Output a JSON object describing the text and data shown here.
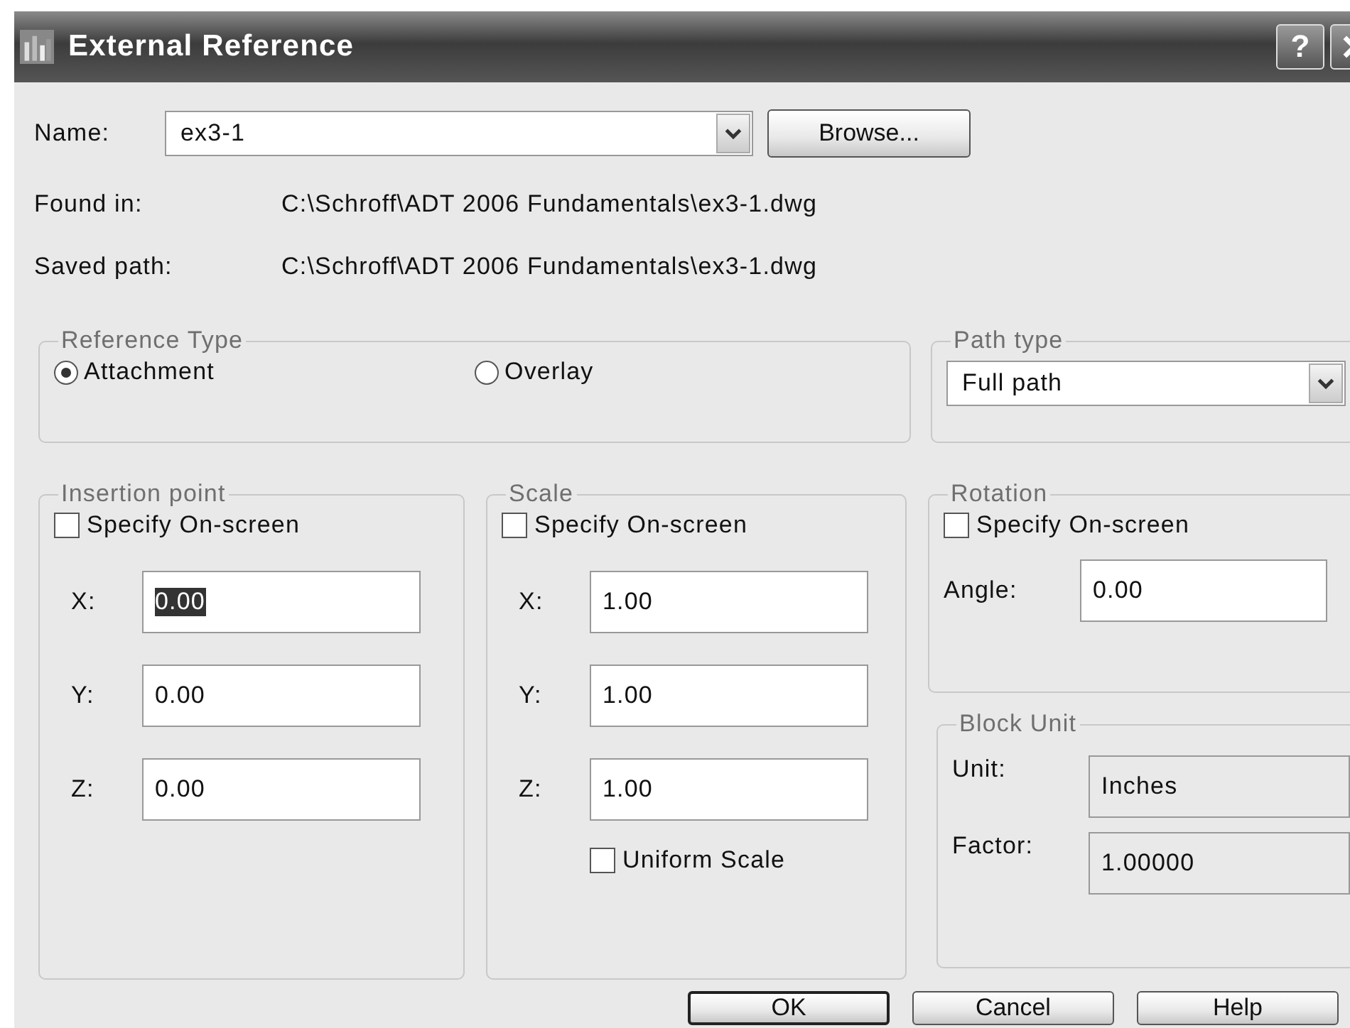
{
  "window": {
    "title": "External Reference",
    "help_button": "?"
  },
  "name": {
    "label": "Name:",
    "value": "ex3-1"
  },
  "browse_button": "Browse...",
  "info": [
    {
      "label": "Found in:",
      "value": "C:\\Schroff\\ADT 2006 Fundamentals\\ex3-1.dwg"
    },
    {
      "label": "Saved path:",
      "value": "C:\\Schroff\\ADT 2006 Fundamentals\\ex3-1.dwg"
    }
  ],
  "reference_type": {
    "title": "Reference Type",
    "options": [
      {
        "label": "Attachment",
        "selected": true
      },
      {
        "label": "Overlay",
        "selected": false
      }
    ]
  },
  "path_type": {
    "title": "Path type",
    "value": "Full path"
  },
  "insertion_point": {
    "title": "Insertion point",
    "specify_on_screen": {
      "label": "Specify On-screen",
      "checked": false
    },
    "fields": [
      {
        "label": "X:",
        "value": "0.00",
        "text_selected": true
      },
      {
        "label": "Y:",
        "value": "0.00",
        "text_selected": false
      },
      {
        "label": "Z:",
        "value": "0.00",
        "text_selected": false
      }
    ]
  },
  "scale": {
    "title": "Scale",
    "specify_on_screen": {
      "label": "Specify On-screen",
      "checked": false
    },
    "fields": [
      {
        "label": "X:",
        "value": "1.00",
        "text_selected": false
      },
      {
        "label": "Y:",
        "value": "1.00",
        "text_selected": false
      },
      {
        "label": "Z:",
        "value": "1.00",
        "text_selected": false
      }
    ],
    "uniform_scale": {
      "label": "Uniform Scale",
      "checked": false
    }
  },
  "rotation": {
    "title": "Rotation",
    "specify_on_screen": {
      "label": "Specify On-screen",
      "checked": false
    },
    "angle": {
      "label": "Angle:",
      "value": "0.00"
    }
  },
  "block_unit": {
    "title": "Block Unit",
    "fields": [
      {
        "label": "Unit:",
        "value": "Inches"
      },
      {
        "label": "Factor:",
        "value": "1.00000"
      }
    ]
  },
  "buttons": [
    {
      "label": "OK",
      "default": true
    },
    {
      "label": "Cancel",
      "default": false
    },
    {
      "label": "Help",
      "default": false
    }
  ]
}
